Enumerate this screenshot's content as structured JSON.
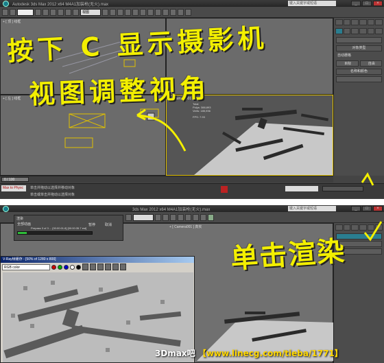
{
  "screen_a": {
    "title": "Autodesk 3ds Max 2012 x64    M4A1加装枪(无火).max",
    "search_placeholder": "键入关键字或短语",
    "viewport_select": "视图",
    "viewport_labels": [
      "+ [ 顶 ] 线框",
      "+ [ 左 ] 线框",
      "+ [ Camera001 ] 真实"
    ],
    "panel_items": [
      "对象类型",
      "自动栅格",
      "目标",
      "自由",
      "名称和颜色"
    ],
    "frame_counter": "0 / 100",
    "status_lines": [
      "单击并拖动以选择并移动对象",
      "单击或单击并拖动以选择对象"
    ],
    "max_to_physc": "Max to Physc",
    "handwriting_line1": "按下 C 显示摄影机",
    "handwriting_line2": "视图调整视角",
    "cam_stats": [
      "Total",
      "Polys: 388,893",
      "Verts: 185,936",
      "FPS: 7.93"
    ]
  },
  "screen_b": {
    "title": "3ds Max 2012 x64    M4A1加装枪(无火).max",
    "render_dialog_title": "渲染",
    "render_dialog_rows": [
      "全部动画",
      "Prepass 3 of 3 ... [00:00:01.8] [00:00:35.7 est]"
    ],
    "pause_label": "暂停",
    "cancel_label": "取消",
    "vfb_title": "V-Ray帧缓存 - [50% of 1280 x 800]",
    "vfb_channel": "RGB color",
    "handwriting": "单击渲染"
  },
  "watermark_prefix": "3Dmax吧",
  "watermark_url": "【www.linecg.com/tieba/1771】"
}
